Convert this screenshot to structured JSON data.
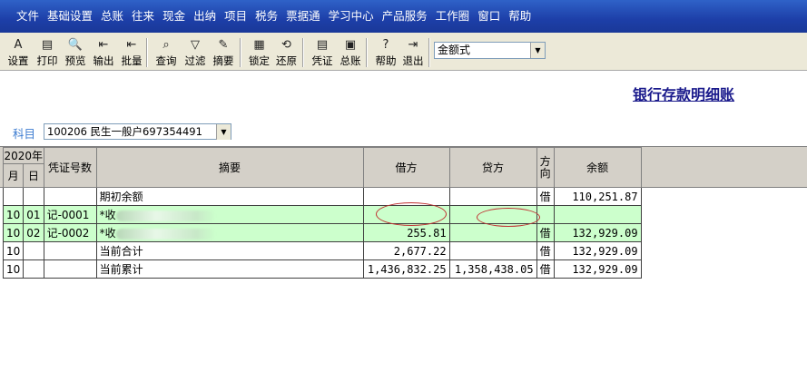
{
  "menu": [
    "文件",
    "基础设置",
    "总账",
    "往来",
    "现金",
    "出纳",
    "项目",
    "税务",
    "票据通",
    "学习中心",
    "产品服务",
    "工作圈",
    "窗口",
    "帮助"
  ],
  "toolbar": [
    {
      "label": "设置",
      "icon": "A",
      "name": "setup"
    },
    {
      "label": "打印",
      "icon": "▤",
      "name": "print"
    },
    {
      "label": "预览",
      "icon": "🔍",
      "name": "preview"
    },
    {
      "label": "输出",
      "icon": "⇤",
      "name": "export"
    },
    {
      "label": "批量",
      "icon": "⇤",
      "name": "batch"
    },
    {
      "label": "查询",
      "icon": "⌕",
      "name": "query"
    },
    {
      "label": "过滤",
      "icon": "▽",
      "name": "filter"
    },
    {
      "label": "摘要",
      "icon": "✎",
      "name": "summary"
    },
    {
      "label": "锁定",
      "icon": "▦",
      "name": "lock"
    },
    {
      "label": "还原",
      "icon": "⟲",
      "name": "restore"
    },
    {
      "label": "凭证",
      "icon": "▤",
      "name": "voucher"
    },
    {
      "label": "总账",
      "icon": "▣",
      "name": "ledger"
    },
    {
      "label": "帮助",
      "icon": "?",
      "name": "help"
    },
    {
      "label": "退出",
      "icon": "⇥",
      "name": "exit"
    }
  ],
  "format_select": "金额式",
  "title": "银行存款明细账",
  "subject": {
    "label": "科目",
    "value": "100206 民生一般户697354491"
  },
  "headers": {
    "year": "2020年",
    "month": "月",
    "day": "日",
    "voucher": "凭证号数",
    "summary": "摘要",
    "debit": "借方",
    "credit": "贷方",
    "direction": "方向",
    "balance": "余额"
  },
  "rows": [
    {
      "month": "",
      "day": "",
      "voucher": "",
      "summary": "期初余额",
      "debit": "",
      "credit": "",
      "direction": "借",
      "balance": "110,251.87",
      "green": false
    },
    {
      "month": "10",
      "day": "01",
      "voucher": "记-0001",
      "summary": "*收",
      "debit": "",
      "credit": "",
      "direction": "",
      "balance": "",
      "green": true
    },
    {
      "month": "10",
      "day": "02",
      "voucher": "记-0002",
      "summary": "*收",
      "debit": "255.81",
      "credit": "",
      "direction": "借",
      "balance": "132,929.09",
      "green": true
    },
    {
      "month": "10",
      "day": "",
      "voucher": "",
      "summary": "当前合计",
      "debit": "2,677.22",
      "credit": "",
      "direction": "借",
      "balance": "132,929.09",
      "green": false
    },
    {
      "month": "10",
      "day": "",
      "voucher": "",
      "summary": "当前累计",
      "debit": "1,436,832.25",
      "credit": "1,358,438.05",
      "direction": "借",
      "balance": "132,929.09",
      "green": false
    }
  ]
}
